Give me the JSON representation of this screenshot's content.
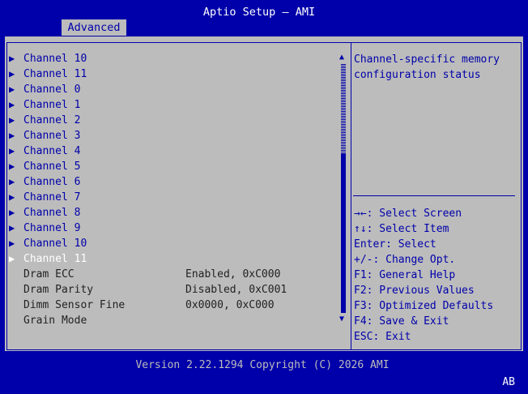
{
  "header": {
    "title": "Aptio Setup – AMI",
    "tab": "Advanced"
  },
  "menu": {
    "links": [
      {
        "label": "Channel 10"
      },
      {
        "label": "Channel 11"
      },
      {
        "label": "Channel 0"
      },
      {
        "label": "Channel 1"
      },
      {
        "label": "Channel 2"
      },
      {
        "label": "Channel 3"
      },
      {
        "label": "Channel 4"
      },
      {
        "label": "Channel 5"
      },
      {
        "label": "Channel 6"
      },
      {
        "label": "Channel 7"
      },
      {
        "label": "Channel 8"
      },
      {
        "label": "Channel 9"
      },
      {
        "label": "Channel 10"
      },
      {
        "label": "Channel 11"
      }
    ],
    "settings": [
      {
        "label": "Dram ECC",
        "value": "Enabled, 0xC000"
      },
      {
        "label": "Dram Parity",
        "value": "Disabled, 0xC001"
      },
      {
        "label": "Dimm Sensor Fine",
        "value": "0x0000, 0xC000"
      },
      {
        "label": "Grain Mode",
        "value": ""
      }
    ]
  },
  "help": {
    "line1": "Channel-specific memory",
    "line2": "configuration status"
  },
  "keys": [
    {
      "text": "→←: Select Screen"
    },
    {
      "text": "↑↓: Select Item"
    },
    {
      "text": "Enter: Select"
    },
    {
      "text": "+/-: Change Opt."
    },
    {
      "text": "F1: General Help"
    },
    {
      "text": "F2: Previous Values"
    },
    {
      "text": "F3: Optimized Defaults"
    },
    {
      "text": "F4: Save & Exit"
    },
    {
      "text": "ESC: Exit"
    }
  ],
  "footer": {
    "version": "Version 2.22.1294 Copyright (C) 2026 AMI",
    "corner": "AB"
  },
  "colors": {
    "background": "#0000aa",
    "panel": "#bcbcbc",
    "highlight": "#ffffff"
  }
}
